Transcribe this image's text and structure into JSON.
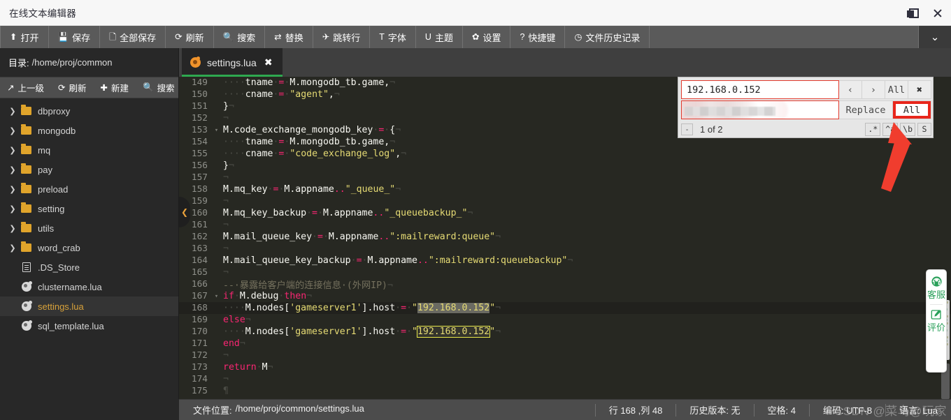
{
  "window": {
    "title": "在线文本编辑器",
    "restore_label": "restore-window",
    "close_label": "close-window"
  },
  "toolbar": {
    "items": [
      {
        "icon": "upload-icon",
        "glyph": "⬆",
        "label": "打开"
      },
      {
        "icon": "save-icon",
        "glyph": "💾",
        "label": "保存"
      },
      {
        "icon": "save-all-icon",
        "glyph": "🗋",
        "label": "全部保存"
      },
      {
        "icon": "refresh-icon",
        "glyph": "⟳",
        "label": "刷新"
      },
      {
        "icon": "search-icon",
        "glyph": "🔍",
        "label": "搜索"
      },
      {
        "icon": "replace-icon",
        "glyph": "⇄",
        "label": "替换"
      },
      {
        "icon": "goto-line-icon",
        "glyph": "✈",
        "label": "跳转行"
      },
      {
        "icon": "font-icon",
        "glyph": "T",
        "label": "字体"
      },
      {
        "icon": "theme-icon",
        "glyph": "U",
        "label": "主题"
      },
      {
        "icon": "settings-icon",
        "glyph": "✿",
        "label": "设置"
      },
      {
        "icon": "hotkey-icon",
        "glyph": "?",
        "label": "快捷键"
      },
      {
        "icon": "history-icon",
        "glyph": "◷",
        "label": "文件历史记录"
      }
    ],
    "expand_glyph": "⌄"
  },
  "sidebar": {
    "dir_label": "目录:",
    "dir_path": "/home/proj/common",
    "actions": [
      {
        "icon": "up-level-icon",
        "glyph": "↗",
        "label": "上一级"
      },
      {
        "icon": "refresh-icon",
        "glyph": "⟳",
        "label": "刷新"
      },
      {
        "icon": "new-icon",
        "glyph": "✚",
        "label": "新建"
      },
      {
        "icon": "search-icon",
        "glyph": "🔍",
        "label": "搜索"
      }
    ],
    "tree": [
      {
        "label": "dbproxy",
        "type": "folder",
        "expandable": true,
        "selected": false
      },
      {
        "label": "mongodb",
        "type": "folder",
        "expandable": true,
        "selected": false
      },
      {
        "label": "mq",
        "type": "folder",
        "expandable": true,
        "selected": false
      },
      {
        "label": "pay",
        "type": "folder",
        "expandable": true,
        "selected": false
      },
      {
        "label": "preload",
        "type": "folder",
        "expandable": true,
        "selected": false
      },
      {
        "label": "setting",
        "type": "folder",
        "expandable": true,
        "selected": false
      },
      {
        "label": "utils",
        "type": "folder",
        "expandable": true,
        "selected": false
      },
      {
        "label": "word_crab",
        "type": "folder",
        "expandable": true,
        "selected": false
      },
      {
        "label": ".DS_Store",
        "type": "doc",
        "expandable": false,
        "selected": false
      },
      {
        "label": "clustername.lua",
        "type": "lua",
        "expandable": false,
        "selected": false
      },
      {
        "label": "settings.lua",
        "type": "lua",
        "expandable": false,
        "selected": true
      },
      {
        "label": "sql_template.lua",
        "type": "lua",
        "expandable": false,
        "selected": false
      }
    ]
  },
  "tab": {
    "name": "settings.lua",
    "close_glyph": "✖",
    "icon": "lua-file-icon"
  },
  "editor": {
    "first_line": 149,
    "lines": [
      {
        "n": 149,
        "fold": "",
        "cur": false,
        "tokens": [
          {
            "t": "ws",
            "v": "····"
          },
          {
            "t": "id",
            "v": "tname"
          },
          {
            "t": "ws",
            "v": "·"
          },
          {
            "t": "kw",
            "v": "="
          },
          {
            "t": "ws",
            "v": "·"
          },
          {
            "t": "id",
            "v": "M.mongodb_tb.game,"
          },
          {
            "t": "eol",
            "v": "¬"
          }
        ]
      },
      {
        "n": 150,
        "fold": "",
        "cur": false,
        "tokens": [
          {
            "t": "ws",
            "v": "····"
          },
          {
            "t": "id",
            "v": "cname"
          },
          {
            "t": "ws",
            "v": "·"
          },
          {
            "t": "kw",
            "v": "="
          },
          {
            "t": "ws",
            "v": "·"
          },
          {
            "t": "str",
            "v": "\"agent\""
          },
          {
            "t": "id",
            "v": ","
          },
          {
            "t": "eol",
            "v": "¬"
          }
        ]
      },
      {
        "n": 151,
        "fold": "",
        "cur": false,
        "tokens": [
          {
            "t": "id",
            "v": "}"
          },
          {
            "t": "eol",
            "v": "¬"
          }
        ]
      },
      {
        "n": 152,
        "fold": "",
        "cur": false,
        "tokens": [
          {
            "t": "eol",
            "v": "¬"
          }
        ]
      },
      {
        "n": 153,
        "fold": "▾",
        "cur": false,
        "tokens": [
          {
            "t": "id",
            "v": "M.code_exchange_mongodb_key"
          },
          {
            "t": "ws",
            "v": "·"
          },
          {
            "t": "kw",
            "v": "="
          },
          {
            "t": "ws",
            "v": "·"
          },
          {
            "t": "id",
            "v": "{"
          },
          {
            "t": "eol",
            "v": "¬"
          }
        ]
      },
      {
        "n": 154,
        "fold": "",
        "cur": false,
        "tokens": [
          {
            "t": "ws",
            "v": "····"
          },
          {
            "t": "id",
            "v": "tname"
          },
          {
            "t": "ws",
            "v": "·"
          },
          {
            "t": "kw",
            "v": "="
          },
          {
            "t": "ws",
            "v": "·"
          },
          {
            "t": "id",
            "v": "M.mongodb_tb.game,"
          },
          {
            "t": "eol",
            "v": "¬"
          }
        ]
      },
      {
        "n": 155,
        "fold": "",
        "cur": false,
        "tokens": [
          {
            "t": "ws",
            "v": "····"
          },
          {
            "t": "id",
            "v": "cname"
          },
          {
            "t": "ws",
            "v": "·"
          },
          {
            "t": "kw",
            "v": "="
          },
          {
            "t": "ws",
            "v": "·"
          },
          {
            "t": "str",
            "v": "\"code_exchange_log\""
          },
          {
            "t": "id",
            "v": ","
          },
          {
            "t": "eol",
            "v": "¬"
          }
        ]
      },
      {
        "n": 156,
        "fold": "",
        "cur": false,
        "tokens": [
          {
            "t": "id",
            "v": "}"
          },
          {
            "t": "eol",
            "v": "¬"
          }
        ]
      },
      {
        "n": 157,
        "fold": "",
        "cur": false,
        "tokens": [
          {
            "t": "eol",
            "v": "¬"
          }
        ]
      },
      {
        "n": 158,
        "fold": "",
        "cur": false,
        "tokens": [
          {
            "t": "id",
            "v": "M.mq_key"
          },
          {
            "t": "ws",
            "v": "·"
          },
          {
            "t": "kw",
            "v": "="
          },
          {
            "t": "ws",
            "v": "·"
          },
          {
            "t": "id",
            "v": "M.appname"
          },
          {
            "t": "kw",
            "v": ".."
          },
          {
            "t": "str",
            "v": "\"_queue_\""
          },
          {
            "t": "eol",
            "v": "¬"
          }
        ]
      },
      {
        "n": 159,
        "fold": "",
        "cur": false,
        "tokens": [
          {
            "t": "eol",
            "v": "¬"
          }
        ]
      },
      {
        "n": 160,
        "fold": "",
        "cur": false,
        "tokens": [
          {
            "t": "id",
            "v": "M.mq_key_backup"
          },
          {
            "t": "ws",
            "v": "·"
          },
          {
            "t": "kw",
            "v": "="
          },
          {
            "t": "ws",
            "v": "·"
          },
          {
            "t": "id",
            "v": "M.appname"
          },
          {
            "t": "kw",
            "v": ".."
          },
          {
            "t": "str",
            "v": "\"_queuebackup_\""
          },
          {
            "t": "eol",
            "v": "¬"
          }
        ]
      },
      {
        "n": 161,
        "fold": "",
        "cur": false,
        "tokens": [
          {
            "t": "eol",
            "v": "¬"
          }
        ]
      },
      {
        "n": 162,
        "fold": "",
        "cur": false,
        "tokens": [
          {
            "t": "id",
            "v": "M.mail_queue_key"
          },
          {
            "t": "ws",
            "v": "·"
          },
          {
            "t": "kw",
            "v": "="
          },
          {
            "t": "ws",
            "v": "·"
          },
          {
            "t": "id",
            "v": "M.appname"
          },
          {
            "t": "kw",
            "v": ".."
          },
          {
            "t": "str",
            "v": "\":mailreward:queue\""
          },
          {
            "t": "eol",
            "v": "¬"
          }
        ]
      },
      {
        "n": 163,
        "fold": "",
        "cur": false,
        "tokens": [
          {
            "t": "eol",
            "v": "¬"
          }
        ]
      },
      {
        "n": 164,
        "fold": "",
        "cur": false,
        "tokens": [
          {
            "t": "id",
            "v": "M.mail_queue_key_backup"
          },
          {
            "t": "ws",
            "v": "·"
          },
          {
            "t": "kw",
            "v": "="
          },
          {
            "t": "ws",
            "v": "·"
          },
          {
            "t": "id",
            "v": "M.appname"
          },
          {
            "t": "kw",
            "v": ".."
          },
          {
            "t": "str",
            "v": "\":mailreward:queuebackup\""
          },
          {
            "t": "eol",
            "v": "¬"
          }
        ]
      },
      {
        "n": 165,
        "fold": "",
        "cur": false,
        "tokens": [
          {
            "t": "eol",
            "v": "¬"
          }
        ]
      },
      {
        "n": 166,
        "fold": "",
        "cur": false,
        "tokens": [
          {
            "t": "com",
            "v": "--·暴露给客户端的连接信息·(外网IP)"
          },
          {
            "t": "eol",
            "v": "¬"
          }
        ]
      },
      {
        "n": 167,
        "fold": "▾",
        "cur": false,
        "tokens": [
          {
            "t": "kw",
            "v": "if"
          },
          {
            "t": "ws",
            "v": "·"
          },
          {
            "t": "id",
            "v": "M.debug"
          },
          {
            "t": "ws",
            "v": "·"
          },
          {
            "t": "kw",
            "v": "then"
          },
          {
            "t": "eol",
            "v": "¬"
          }
        ]
      },
      {
        "n": 168,
        "fold": "",
        "cur": true,
        "tokens": [
          {
            "t": "ws",
            "v": "····"
          },
          {
            "t": "id",
            "v": "M.nodes["
          },
          {
            "t": "str",
            "v": "'gameserver1'"
          },
          {
            "t": "id",
            "v": "].host"
          },
          {
            "t": "ws",
            "v": "·"
          },
          {
            "t": "kw",
            "v": "="
          },
          {
            "t": "ws",
            "v": "·"
          },
          {
            "t": "str",
            "v": "\""
          },
          {
            "t": "hl-sel",
            "v": "192.168.0.152"
          },
          {
            "t": "str",
            "v": "\""
          },
          {
            "t": "eol",
            "v": "¬"
          }
        ]
      },
      {
        "n": 169,
        "fold": "",
        "cur": false,
        "tokens": [
          {
            "t": "kw",
            "v": "else"
          },
          {
            "t": "eol",
            "v": "¬"
          }
        ]
      },
      {
        "n": 170,
        "fold": "",
        "cur": false,
        "tokens": [
          {
            "t": "ws",
            "v": "····"
          },
          {
            "t": "id",
            "v": "M.nodes["
          },
          {
            "t": "str",
            "v": "'gameserver1'"
          },
          {
            "t": "id",
            "v": "].host"
          },
          {
            "t": "ws",
            "v": "·"
          },
          {
            "t": "kw",
            "v": "="
          },
          {
            "t": "ws",
            "v": "·"
          },
          {
            "t": "str",
            "v": "\""
          },
          {
            "t": "hl-box",
            "v": "192.168.0.152"
          },
          {
            "t": "str",
            "v": "\""
          },
          {
            "t": "eol",
            "v": "¬"
          }
        ]
      },
      {
        "n": 171,
        "fold": "",
        "cur": false,
        "tokens": [
          {
            "t": "kw",
            "v": "end"
          },
          {
            "t": "eol",
            "v": "¬"
          }
        ]
      },
      {
        "n": 172,
        "fold": "",
        "cur": false,
        "tokens": [
          {
            "t": "eol",
            "v": "¬"
          }
        ]
      },
      {
        "n": 173,
        "fold": "",
        "cur": false,
        "tokens": [
          {
            "t": "kw",
            "v": "return"
          },
          {
            "t": "ws",
            "v": "·"
          },
          {
            "t": "id",
            "v": "M"
          },
          {
            "t": "eol",
            "v": "¬"
          }
        ]
      },
      {
        "n": 174,
        "fold": "",
        "cur": false,
        "tokens": [
          {
            "t": "eol",
            "v": "¬"
          }
        ]
      },
      {
        "n": 175,
        "fold": "",
        "cur": false,
        "tokens": [
          {
            "t": "eol",
            "v": "¶"
          }
        ]
      }
    ]
  },
  "search_panel": {
    "find_value": "192.168.0.152",
    "find_placeholder": "",
    "replace_value": "",
    "replace_placeholder": "",
    "prev_glyph": "‹",
    "next_glyph": "›",
    "all_label": "All",
    "close_glyph": "✖",
    "replace_label": "Replace",
    "replace_all_label": "All",
    "minus_label": "-",
    "match_count": "1 of 2",
    "flags": [
      ".*",
      "^a",
      "\\b",
      "S"
    ]
  },
  "side_widget": {
    "service_icon": "headset-icon",
    "service_label": "客服",
    "rate_icon": "pencil-square-icon",
    "rate_label": "评价"
  },
  "status_bar": {
    "file_location_label": "文件位置:",
    "file_location_value": "/home/proj/common/settings.lua",
    "cells": [
      "行 168 ,列 48",
      "历史版本: 无",
      "空格: 4",
      "编码: UTF-8",
      "语言: Lua"
    ]
  },
  "watermark": "CSDN @菜鸟@玩家",
  "colors": {
    "accent_green": "#2ea84f",
    "folder": "#e0a42b",
    "selected_file": "#d7a13a",
    "annotation_red": "#f03d2e",
    "editor_bg": "#272822",
    "toolbar_bg": "#5a5a5a"
  }
}
